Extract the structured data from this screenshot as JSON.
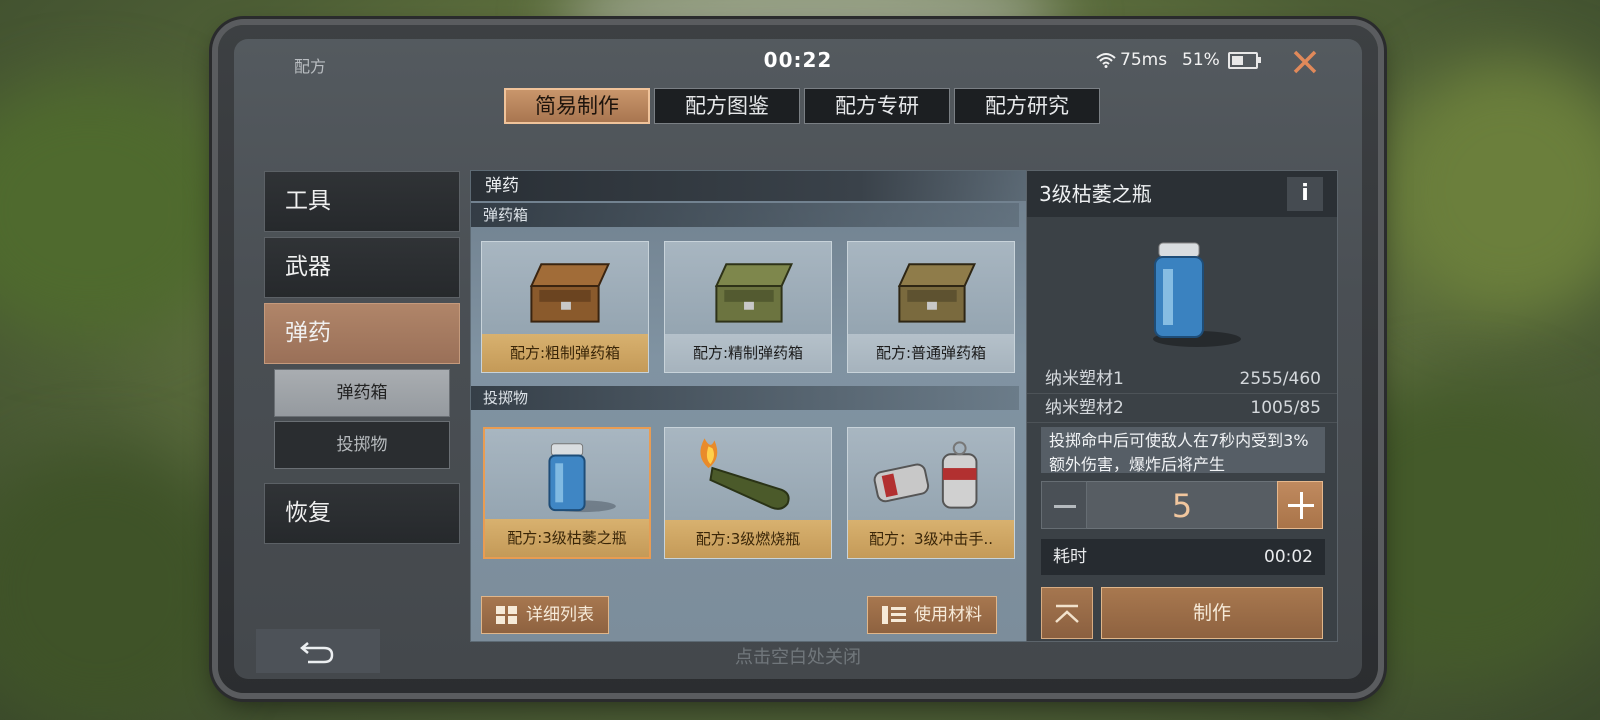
{
  "status": {
    "title": "配方",
    "timer": "00:22",
    "ping": "75ms",
    "battery_text": "51%",
    "battery_level": 0.51
  },
  "tabs": [
    "简易制作",
    "配方图鉴",
    "配方专研",
    "配方研究"
  ],
  "sidebar": {
    "items": [
      "工具",
      "武器",
      "弹药",
      "恢复"
    ],
    "sub_items": [
      "弹药箱",
      "投掷物"
    ]
  },
  "panel": {
    "header": "弹药",
    "sections": [
      {
        "label": "弹药箱",
        "cards": [
          "配方:粗制弹药箱",
          "配方:精制弹药箱",
          "配方:普通弹药箱"
        ]
      },
      {
        "label": "投掷物",
        "cards": [
          "配方:3级枯萎之瓶",
          "配方:3级燃烧瓶",
          "配方：3级冲击手.."
        ]
      }
    ],
    "detail_list_label": "详细列表",
    "use_materials_label": "使用材料"
  },
  "detail": {
    "title": "3级枯萎之瓶",
    "info_label": "i",
    "materials": [
      {
        "name": "纳米塑材1",
        "amount": "2555/460"
      },
      {
        "name": "纳米塑材2",
        "amount": "1005/85"
      }
    ],
    "description": "投掷命中后可使敌人在7秒内受到3%额外伤害，爆炸后将产生",
    "quantity": "5",
    "time_label": "耗时",
    "time_value": "00:02",
    "craft_label": "制作"
  },
  "close_hint": "点击空白处关闭",
  "colors": {
    "accent": "#b08569",
    "accent_bright": "#e99c52",
    "close_icon": "#e0895a"
  }
}
